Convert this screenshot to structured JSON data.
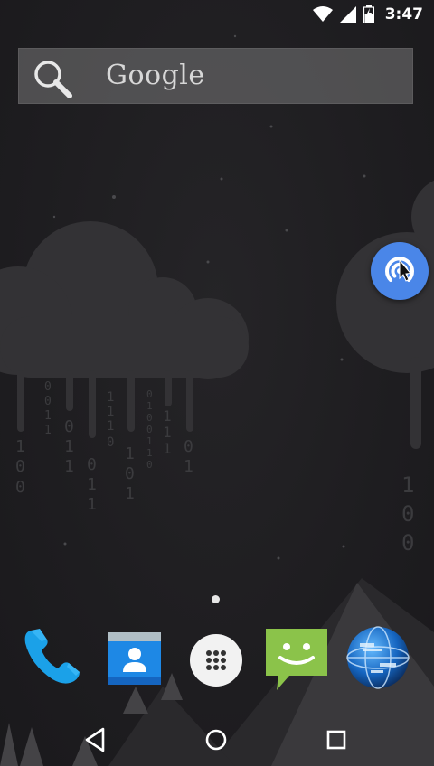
{
  "status_bar": {
    "time": "3:47",
    "icons": [
      "wifi-icon",
      "signal-icon",
      "battery-charging-icon"
    ]
  },
  "search_widget": {
    "label": "Google",
    "icon": "search-icon"
  },
  "floating_button": {
    "icon": "wireless-signal-icon",
    "color": "#4a86e8"
  },
  "wallpaper": {
    "binary_strings": [
      "100",
      "0011",
      "011",
      "011",
      "11",
      "1110",
      "101",
      "01001100",
      "111",
      "01",
      "100"
    ]
  },
  "home": {
    "page_indicator": {
      "pages": 1,
      "current": 1
    }
  },
  "dock": {
    "apps": [
      {
        "name": "Phone",
        "icon": "phone-icon"
      },
      {
        "name": "Contacts",
        "icon": "contacts-icon"
      },
      {
        "name": "All apps",
        "icon": "app-drawer-icon"
      },
      {
        "name": "Messaging",
        "icon": "messaging-icon"
      },
      {
        "name": "Browser",
        "icon": "globe-icon"
      }
    ]
  },
  "nav_bar": {
    "buttons": [
      "back",
      "home",
      "recents"
    ]
  },
  "colors": {
    "background": "#1d1c1f",
    "wallpaper_shape": "#353437",
    "accent_blue": "#4a86e8",
    "phone_blue": "#1ba1e8",
    "message_green": "#8bc34a"
  }
}
